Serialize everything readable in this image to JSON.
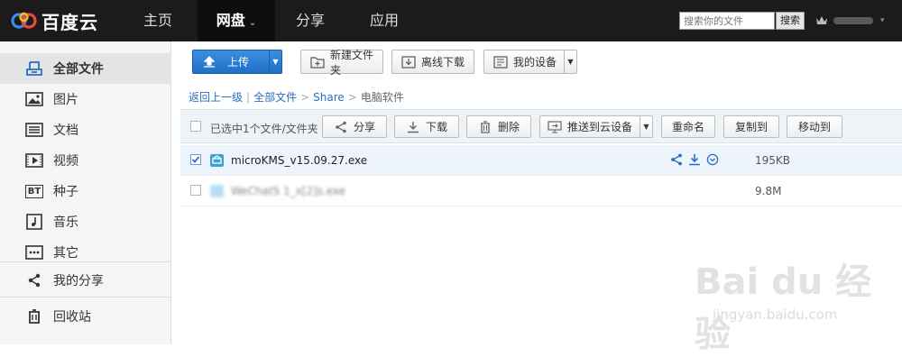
{
  "app": {
    "logo_text": "百度云"
  },
  "topnav": {
    "items": [
      {
        "label": "主页"
      },
      {
        "label": "网盘",
        "caret": "⌄"
      },
      {
        "label": "分享"
      },
      {
        "label": "应用"
      }
    ]
  },
  "search": {
    "placeholder": "搜索你的文件",
    "button": "搜索"
  },
  "user": {
    "caret": "▾",
    "avatar_icon": "crown-icon"
  },
  "sidebar": {
    "items": [
      {
        "label": "全部文件",
        "icon": "cloud-files-icon"
      },
      {
        "label": "图片",
        "icon": "image-icon"
      },
      {
        "label": "文档",
        "icon": "document-icon"
      },
      {
        "label": "视频",
        "icon": "video-icon"
      },
      {
        "label": "种子",
        "icon": "bt-icon",
        "icon_text": "BT"
      },
      {
        "label": "音乐",
        "icon": "music-icon"
      },
      {
        "label": "其它",
        "icon": "more-icon"
      },
      {
        "label": "我的分享",
        "icon": "share-icon"
      },
      {
        "label": "回收站",
        "icon": "trash-icon"
      }
    ]
  },
  "toolbar": {
    "upload": "上传",
    "new_folder": "新建文件夹",
    "offline_download": "离线下载",
    "my_devices": "我的设备"
  },
  "breadcrumb": {
    "back": "返回上一级",
    "root": "全部文件",
    "folder": "Share",
    "current": "电脑软件",
    "separator": "|",
    "arrow": ">"
  },
  "selection_bar": {
    "label": "已选中1个文件/文件夹",
    "share": "分享",
    "download": "下载",
    "delete": "删除",
    "push": "推送到云设备",
    "rename": "重命名",
    "copy": "复制到",
    "move": "移动到"
  },
  "files": [
    {
      "name": "microKMS_v15.09.27.exe",
      "size": "195KB",
      "checked": true
    },
    {
      "name": "WeChatS 1_x[2]s.exe",
      "size": "9.8M",
      "checked": false
    }
  ],
  "watermark": {
    "logo": "Bai du 经验",
    "url": "jingyan.baidu.com"
  },
  "colors": {
    "topbar": "#1b1b1b",
    "accent_blue": "#2b6ec3",
    "upload_button": "#1f6fc6",
    "selected_row": "#eef4fb"
  }
}
